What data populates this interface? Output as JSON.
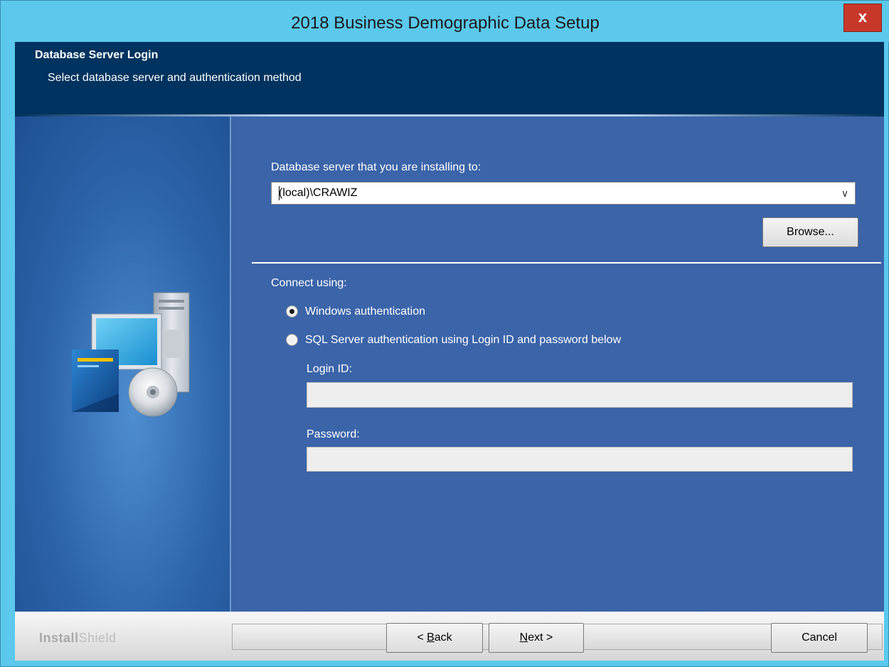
{
  "window": {
    "title": "2018 Business Demographic Data Setup",
    "close_label": "x"
  },
  "header": {
    "title": "Database Server Login",
    "subtitle": "Select database server and authentication method"
  },
  "form": {
    "server_label": "Database server that you are installing to:",
    "server_value": "(local)\\CRAWIZ",
    "browse_label": "Browse...",
    "connect_label": "Connect using:",
    "radio_windows_label": "Windows authentication",
    "radio_sql_label": "SQL Server authentication using Login ID and password below",
    "selected_auth": "Windows authentication",
    "login_label": "Login ID:",
    "login_value": "",
    "password_label": "Password:",
    "password_value": ""
  },
  "footer": {
    "brand_bold": "Install",
    "brand_thin": "Shield",
    "back_prefix": "< ",
    "back_mnemonic": "B",
    "back_rest": "ack",
    "next_mnemonic": "N",
    "next_rest": "ext >",
    "cancel_label": "Cancel"
  },
  "icons": {
    "side_illustration": "computer-with-cd-icon",
    "dropdown": "chevron-down-icon",
    "close": "close-icon"
  },
  "colors": {
    "titlebar": "#5bc8ec",
    "header": "#00335f",
    "main_panel": "#3b64a9",
    "close_button": "#c8382a"
  }
}
